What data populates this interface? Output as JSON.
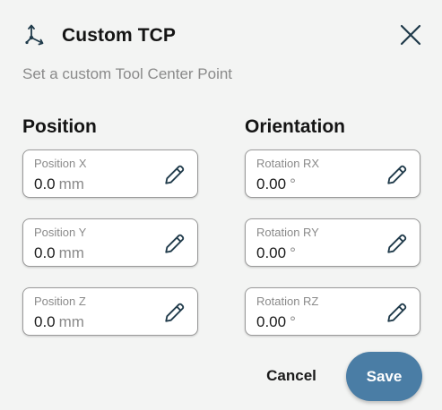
{
  "dialog": {
    "title": "Custom TCP",
    "subtitle": "Set a custom Tool Center Point",
    "header_icon": "tcp-axes-icon",
    "close_icon": "close-icon"
  },
  "position": {
    "heading": "Position",
    "fields": [
      {
        "label": "Position X",
        "value": "0.0",
        "unit": "mm"
      },
      {
        "label": "Position Y",
        "value": "0.0",
        "unit": "mm"
      },
      {
        "label": "Position Z",
        "value": "0.0",
        "unit": "mm"
      }
    ]
  },
  "orientation": {
    "heading": "Orientation",
    "fields": [
      {
        "label": "Rotation RX",
        "value": "0.00",
        "unit": "°"
      },
      {
        "label": "Rotation RY",
        "value": "0.00",
        "unit": "°"
      },
      {
        "label": "Rotation RZ",
        "value": "0.00",
        "unit": "°"
      }
    ]
  },
  "edit_icon": "pencil-icon",
  "actions": {
    "cancel_label": "Cancel",
    "save_label": "Save"
  },
  "colors": {
    "background": "#f3f4f3",
    "primary": "#4a7da5",
    "muted_text": "#8a8a8a",
    "icon": "#1f3a4a"
  }
}
